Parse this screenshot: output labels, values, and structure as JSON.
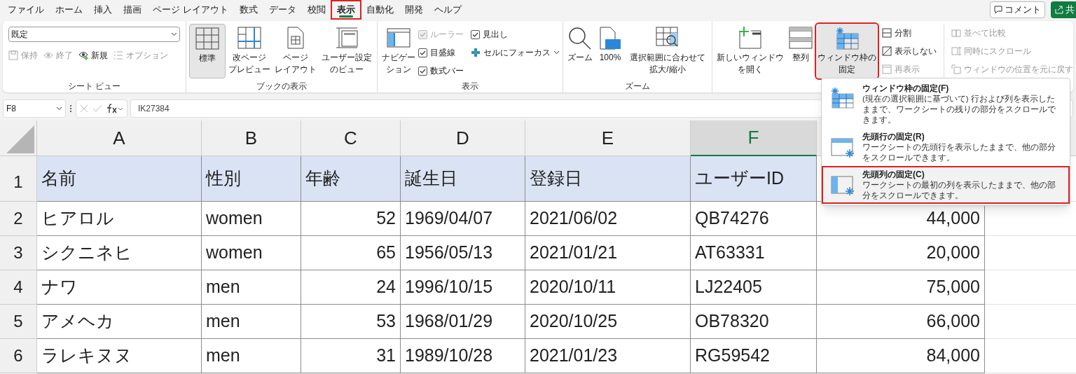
{
  "tabs": [
    {
      "label": "ファイル",
      "selected": false,
      "annotated": false
    },
    {
      "label": "ホーム",
      "selected": false,
      "annotated": false
    },
    {
      "label": "挿入",
      "selected": false,
      "annotated": false
    },
    {
      "label": "描画",
      "selected": false,
      "annotated": false
    },
    {
      "label": "ページ レイアウト",
      "selected": false,
      "annotated": false
    },
    {
      "label": "数式",
      "selected": false,
      "annotated": false
    },
    {
      "label": "データ",
      "selected": false,
      "annotated": false
    },
    {
      "label": "校閲",
      "selected": false,
      "annotated": false
    },
    {
      "label": "表示",
      "selected": true,
      "annotated": true
    },
    {
      "label": "自動化",
      "selected": false,
      "annotated": false
    },
    {
      "label": "開発",
      "selected": false,
      "annotated": false
    },
    {
      "label": "ヘルプ",
      "selected": false,
      "annotated": false
    }
  ],
  "top_buttons": {
    "comment": "コメント",
    "share": "共"
  },
  "ribbon": {
    "sheet_view": {
      "label": "シート ビュー",
      "view_select": "既定",
      "buttons": [
        {
          "kind": "save",
          "label": "保持",
          "disabled": true
        },
        {
          "kind": "exit",
          "label": "終了",
          "disabled": true
        },
        {
          "kind": "new",
          "label": "新規",
          "disabled": false
        },
        {
          "kind": "options",
          "label": "オプション",
          "disabled": true
        }
      ]
    },
    "book_view": {
      "label": "ブックの表示",
      "buttons": [
        {
          "kind": "normal",
          "label": "標準",
          "selected": true
        },
        {
          "kind": "pagebreak",
          "label": [
            "改ページ",
            "プレビュー"
          ],
          "selected": false
        },
        {
          "kind": "pagelayout",
          "label": [
            "ページ",
            "レイアウト"
          ],
          "selected": false
        },
        {
          "kind": "custom",
          "label": [
            "ユーザー設定",
            "のビュー"
          ],
          "selected": false
        }
      ]
    },
    "show": {
      "label": "表示",
      "navigation": [
        "ナビゲー",
        "ション"
      ],
      "checkboxes": [
        {
          "label": "ルーラー",
          "checked": true,
          "disabled": true
        },
        {
          "label": "目盛線",
          "checked": true,
          "disabled": false
        },
        {
          "label": "数式バー",
          "checked": true,
          "disabled": false
        },
        {
          "label": "見出し",
          "checked": true,
          "disabled": false
        }
      ],
      "focus_cell": "セルにフォーカス"
    },
    "zoom": {
      "label": "ズーム",
      "buttons": [
        {
          "kind": "zoom",
          "label": "ズーム"
        },
        {
          "kind": "hundred",
          "label": "100%"
        },
        {
          "kind": "fit",
          "label": [
            "選択範囲に合わせて",
            "拡大/縮小"
          ]
        }
      ]
    },
    "window": {
      "buttons": [
        {
          "kind": "newwindow",
          "label": [
            "新しいウィンドウ",
            "を開く"
          ],
          "annotated": false
        },
        {
          "kind": "arrange",
          "label": "整列",
          "annotated": false
        },
        {
          "kind": "freeze",
          "label": [
            "ウィンドウ枠の",
            "固定"
          ],
          "annotated": true
        }
      ],
      "small_left": [
        {
          "kind": "split",
          "label": "分割",
          "disabled": false
        },
        {
          "kind": "hide",
          "label": "表示しない",
          "disabled": false
        },
        {
          "kind": "unhide",
          "label": "再表示",
          "disabled": true
        }
      ],
      "small_right": [
        {
          "kind": "compare",
          "label": "並べて比較",
          "disabled": true
        },
        {
          "kind": "sync",
          "label": "同時にスクロール",
          "disabled": true
        },
        {
          "kind": "reset",
          "label": "ウィンドウの位置を元に戻す",
          "disabled": true
        }
      ]
    }
  },
  "formula_bar": {
    "name_box": "F8",
    "value": "IK27384"
  },
  "sheet": {
    "columns": [
      {
        "letter": "A",
        "selected": false
      },
      {
        "letter": "B",
        "selected": false
      },
      {
        "letter": "C",
        "selected": false
      },
      {
        "letter": "D",
        "selected": false
      },
      {
        "letter": "E",
        "selected": false
      },
      {
        "letter": "F",
        "selected": true
      }
    ],
    "rows": [
      {
        "number": "1",
        "header": true,
        "cells": [
          "名前",
          "性別",
          "年齢",
          "誕生日",
          "登録日",
          "ユーザーID",
          ""
        ]
      },
      {
        "number": "2",
        "header": false,
        "cells": [
          "ヒアロル",
          "women",
          "52",
          "1969/04/07",
          "2021/06/02",
          "QB74276",
          "44,000"
        ]
      },
      {
        "number": "3",
        "header": false,
        "cells": [
          "シクニネヒ",
          "women",
          "65",
          "1956/05/13",
          "2021/01/21",
          "AT63331",
          "20,000"
        ]
      },
      {
        "number": "4",
        "header": false,
        "cells": [
          "ナワ",
          "men",
          "24",
          "1996/10/15",
          "2020/10/11",
          "LJ22405",
          "75,000"
        ]
      },
      {
        "number": "5",
        "header": false,
        "cells": [
          "アメヘカ",
          "men",
          "53",
          "1968/01/29",
          "2020/10/25",
          "OB78320",
          "66,000"
        ]
      },
      {
        "number": "6",
        "header": false,
        "cells": [
          "ラレキヌヌ",
          "men",
          "31",
          "1989/10/28",
          "2021/01/23",
          "RG59542",
          "84,000"
        ]
      }
    ]
  },
  "freeze_menu": [
    {
      "kind": "panes",
      "title": "ウィンドウ枠の固定(F)",
      "description": "(現在の選択範囲に基づいて) 行および列を表示したままで、ワークシートの残りの部分をスクロールできます。",
      "annotated": false
    },
    {
      "kind": "top_row",
      "title": "先頭行の固定(R)",
      "description": "ワークシートの先頭行を表示したままで、他の部分をスクロールできます。",
      "annotated": false
    },
    {
      "kind": "first_column",
      "title": "先頭列の固定(C)",
      "description": "ワークシートの最初の列を表示したままで、他の部分をスクロールできます。",
      "annotated": true
    }
  ]
}
